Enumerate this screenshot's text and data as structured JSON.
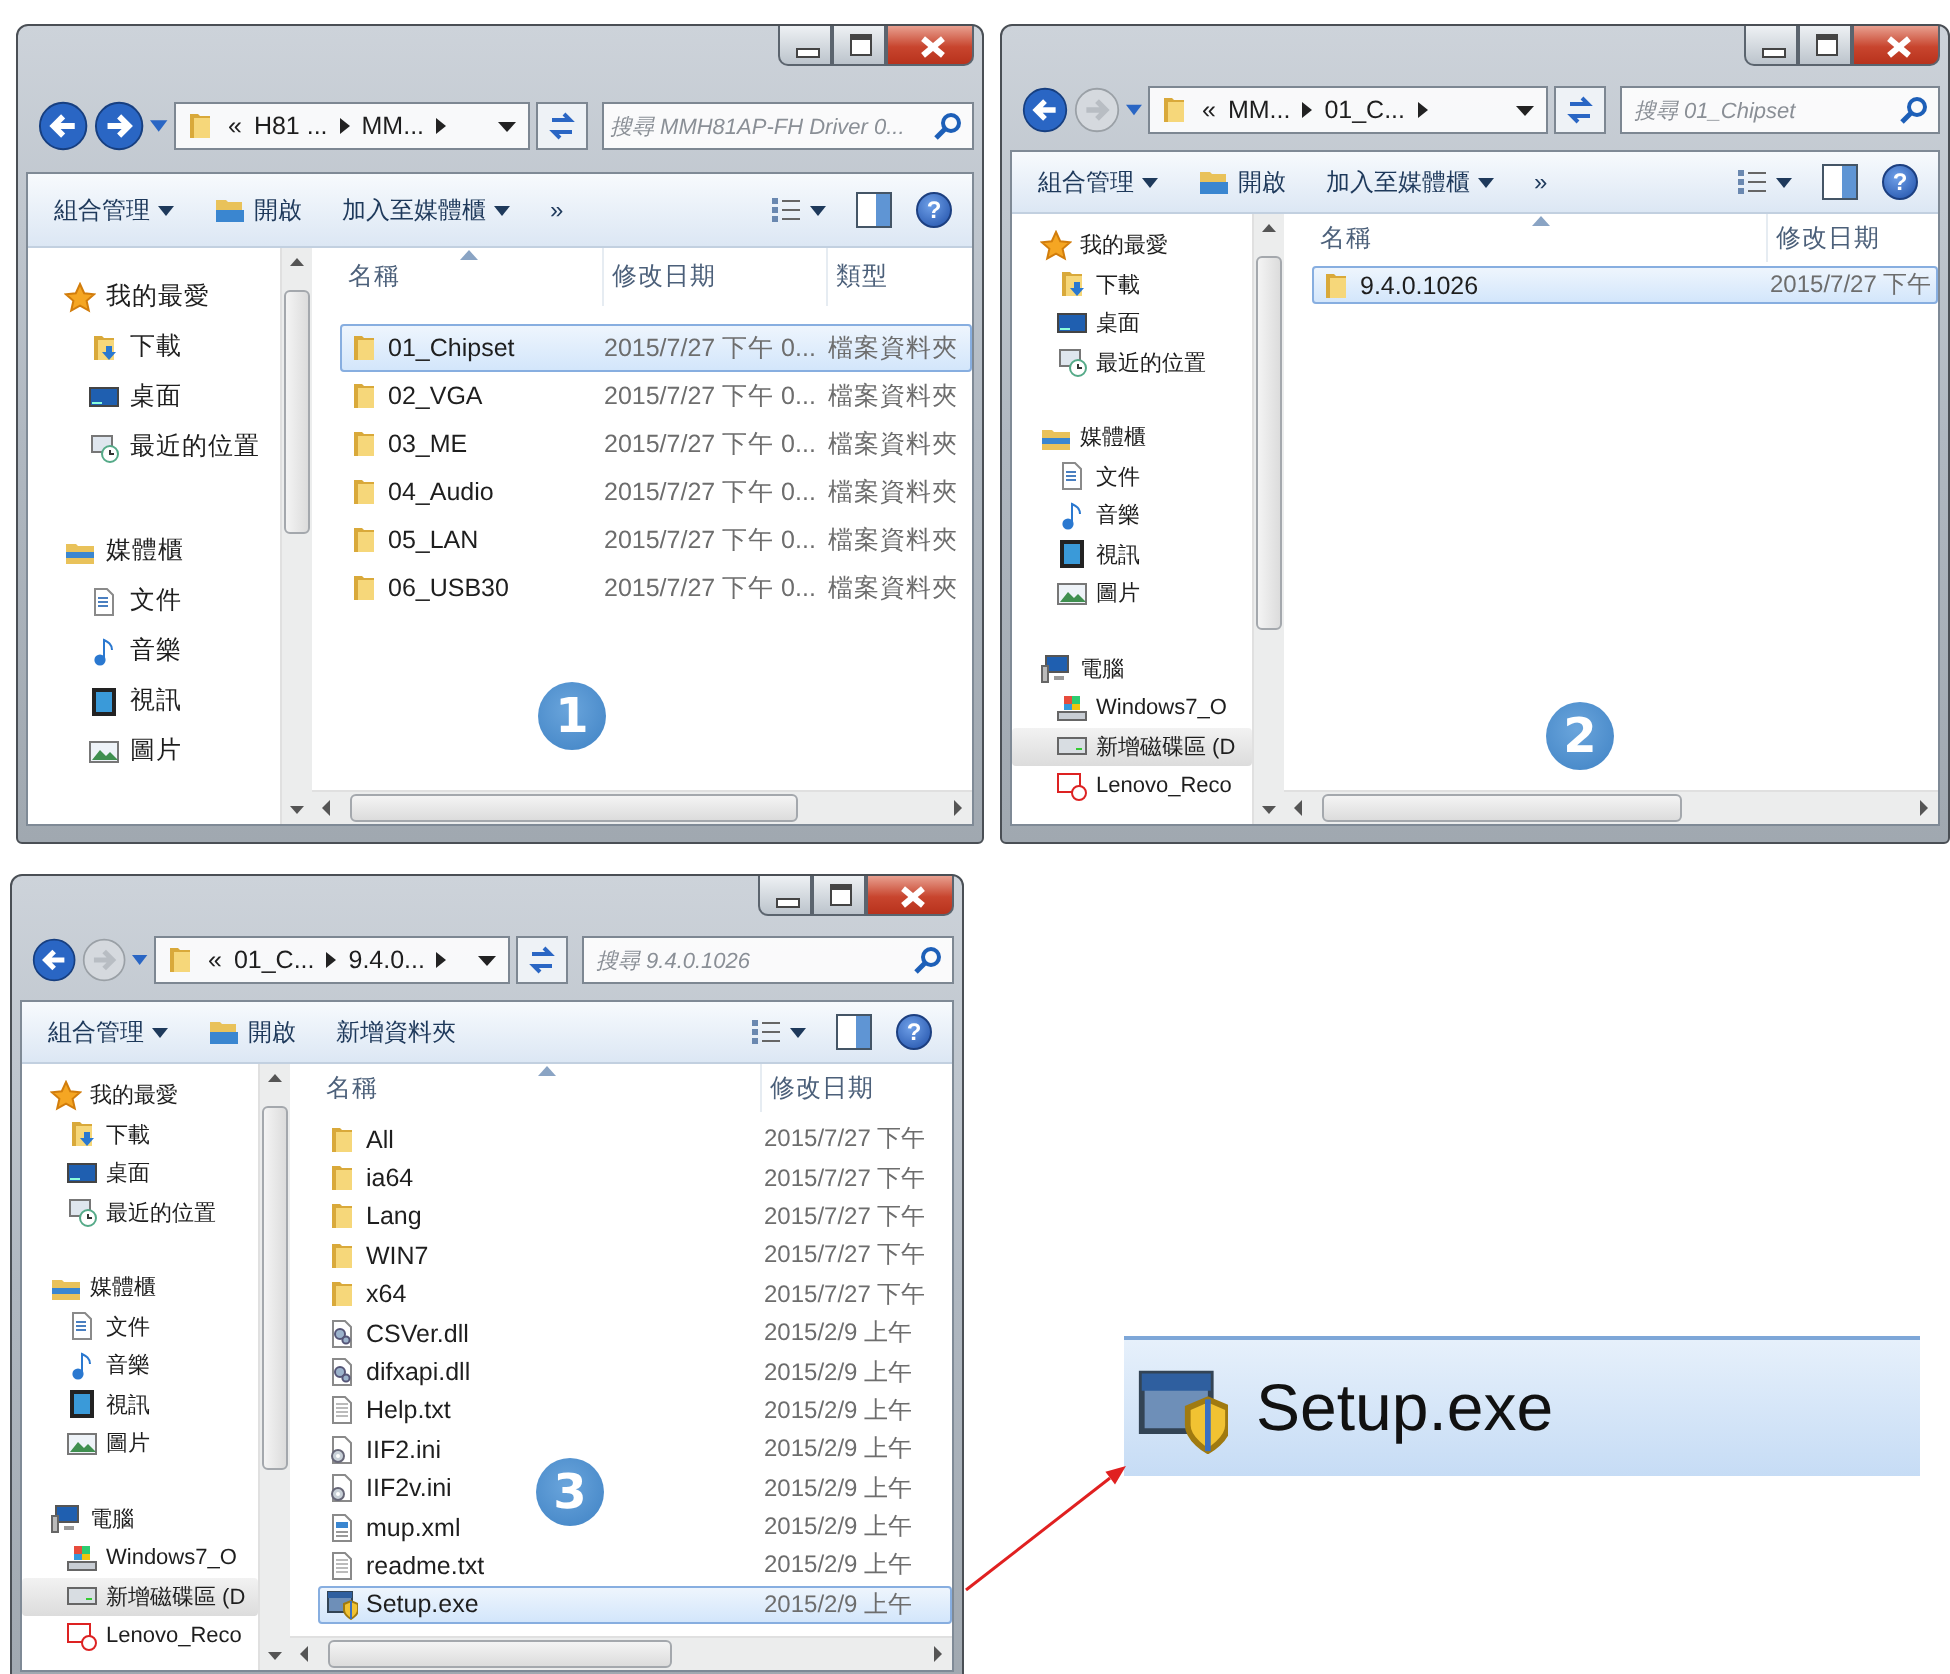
{
  "windows": [
    {
      "step": "1",
      "nav": {
        "forward_enabled": true
      },
      "address": {
        "overflow": "«",
        "segments": [
          "H81 ...",
          "MM..."
        ]
      },
      "search": {
        "placeholder": "搜尋 MMH81AP-FH Driver 0..."
      },
      "toolbar": [
        {
          "label": "組合管理",
          "kind": "menu"
        },
        {
          "label": "開啟",
          "kind": "icon-button"
        },
        {
          "label": "加入至媒體櫃",
          "kind": "menu"
        },
        {
          "label": "»",
          "kind": "more"
        }
      ],
      "help_label": "?",
      "sidebar": [
        {
          "label": "我的最愛",
          "kind": "star",
          "selected": false,
          "children": [
            {
              "label": "下載",
              "kind": "download",
              "selected": false
            },
            {
              "label": "桌面",
              "kind": "desktop",
              "selected": false
            },
            {
              "label": "最近的位置",
              "kind": "recent",
              "selected": false
            }
          ]
        },
        {
          "label": "媒體櫃",
          "kind": "library",
          "selected": false,
          "children": [
            {
              "label": "文件",
              "kind": "document",
              "selected": false
            },
            {
              "label": "音樂",
              "kind": "music",
              "selected": false
            },
            {
              "label": "視訊",
              "kind": "video",
              "selected": false
            },
            {
              "label": "圖片",
              "kind": "picture",
              "selected": false
            }
          ]
        }
      ],
      "columns": [
        "名稱",
        "修改日期",
        "類型"
      ],
      "rows": [
        {
          "name": "01_Chipset",
          "kind": "folder",
          "modified": "2015/7/27 下午 0...",
          "type": "檔案資料夾",
          "selected": true
        },
        {
          "name": "02_VGA",
          "kind": "folder",
          "modified": "2015/7/27 下午 0...",
          "type": "檔案資料夾",
          "selected": false
        },
        {
          "name": "03_ME",
          "kind": "folder",
          "modified": "2015/7/27 下午 0...",
          "type": "檔案資料夾",
          "selected": false
        },
        {
          "name": "04_Audio",
          "kind": "folder",
          "modified": "2015/7/27 下午 0...",
          "type": "檔案資料夾",
          "selected": false
        },
        {
          "name": "05_LAN",
          "kind": "folder",
          "modified": "2015/7/27 下午 0...",
          "type": "檔案資料夾",
          "selected": false
        },
        {
          "name": "06_USB30",
          "kind": "folder",
          "modified": "2015/7/27 下午 0...",
          "type": "檔案資料夾",
          "selected": false
        }
      ]
    },
    {
      "step": "2",
      "nav": {
        "forward_enabled": false
      },
      "address": {
        "overflow": "«",
        "segments": [
          "MM...",
          "01_C..."
        ]
      },
      "search": {
        "placeholder": "搜尋 01_Chipset"
      },
      "toolbar": [
        {
          "label": "組合管理",
          "kind": "menu"
        },
        {
          "label": "開啟",
          "kind": "icon-button"
        },
        {
          "label": "加入至媒體櫃",
          "kind": "menu"
        },
        {
          "label": "»",
          "kind": "more"
        }
      ],
      "help_label": "?",
      "sidebar": [
        {
          "label": "我的最愛",
          "kind": "star",
          "selected": false,
          "children": [
            {
              "label": "下載",
              "kind": "download",
              "selected": false
            },
            {
              "label": "桌面",
              "kind": "desktop",
              "selected": false
            },
            {
              "label": "最近的位置",
              "kind": "recent",
              "selected": false
            }
          ]
        },
        {
          "label": "媒體櫃",
          "kind": "library",
          "selected": false,
          "children": [
            {
              "label": "文件",
              "kind": "document",
              "selected": false
            },
            {
              "label": "音樂",
              "kind": "music",
              "selected": false
            },
            {
              "label": "視訊",
              "kind": "video",
              "selected": false
            },
            {
              "label": "圖片",
              "kind": "picture",
              "selected": false
            }
          ]
        },
        {
          "label": "電腦",
          "kind": "computer",
          "selected": false,
          "children": [
            {
              "label": "Windows7_O",
              "kind": "os-drive",
              "selected": false
            },
            {
              "label": "新增磁碟區 (D",
              "kind": "drive",
              "selected": true
            },
            {
              "label": "Lenovo_Reco",
              "kind": "recovery",
              "selected": false
            }
          ]
        }
      ],
      "columns": [
        "名稱",
        "修改日期"
      ],
      "rows": [
        {
          "name": "9.4.0.1026",
          "kind": "folder",
          "modified": "2015/7/27 下午",
          "selected": true
        }
      ]
    },
    {
      "step": "3",
      "nav": {
        "forward_enabled": false
      },
      "address": {
        "overflow": "«",
        "segments": [
          "01_C...",
          "9.4.0..."
        ]
      },
      "search": {
        "placeholder": "搜尋 9.4.0.1026"
      },
      "toolbar": [
        {
          "label": "組合管理",
          "kind": "menu"
        },
        {
          "label": "開啟",
          "kind": "icon-button"
        },
        {
          "label": "新增資料夾",
          "kind": "plain"
        }
      ],
      "help_label": "?",
      "sidebar": [
        {
          "label": "我的最愛",
          "kind": "star",
          "selected": false,
          "children": [
            {
              "label": "下載",
              "kind": "download",
              "selected": false
            },
            {
              "label": "桌面",
              "kind": "desktop",
              "selected": false
            },
            {
              "label": "最近的位置",
              "kind": "recent",
              "selected": false
            }
          ]
        },
        {
          "label": "媒體櫃",
          "kind": "library",
          "selected": false,
          "children": [
            {
              "label": "文件",
              "kind": "document",
              "selected": false
            },
            {
              "label": "音樂",
              "kind": "music",
              "selected": false
            },
            {
              "label": "視訊",
              "kind": "video",
              "selected": false
            },
            {
              "label": "圖片",
              "kind": "picture",
              "selected": false
            }
          ]
        },
        {
          "label": "電腦",
          "kind": "computer",
          "selected": false,
          "children": [
            {
              "label": "Windows7_O",
              "kind": "os-drive",
              "selected": false
            },
            {
              "label": "新增磁碟區 (D",
              "kind": "drive",
              "selected": true
            },
            {
              "label": "Lenovo_Reco",
              "kind": "recovery",
              "selected": false
            }
          ]
        }
      ],
      "columns": [
        "名稱",
        "修改日期"
      ],
      "rows": [
        {
          "name": "All",
          "kind": "folder",
          "modified": "2015/7/27 下午",
          "selected": false
        },
        {
          "name": "ia64",
          "kind": "folder",
          "modified": "2015/7/27 下午",
          "selected": false
        },
        {
          "name": "Lang",
          "kind": "folder",
          "modified": "2015/7/27 下午",
          "selected": false
        },
        {
          "name": "WIN7",
          "kind": "folder",
          "modified": "2015/7/27 下午",
          "selected": false
        },
        {
          "name": "x64",
          "kind": "folder",
          "modified": "2015/7/27 下午",
          "selected": false
        },
        {
          "name": "CSVer.dll",
          "kind": "dll",
          "modified": "2015/2/9 上午",
          "selected": false
        },
        {
          "name": "difxapi.dll",
          "kind": "dll",
          "modified": "2015/2/9 上午",
          "selected": false
        },
        {
          "name": "Help.txt",
          "kind": "txt",
          "modified": "2015/2/9 上午",
          "selected": false
        },
        {
          "name": "IIF2.ini",
          "kind": "ini",
          "modified": "2015/2/9 上午",
          "selected": false
        },
        {
          "name": "IIF2v.ini",
          "kind": "ini",
          "modified": "2015/2/9 上午",
          "selected": false
        },
        {
          "name": "mup.xml",
          "kind": "xml",
          "modified": "2015/2/9 上午",
          "selected": false
        },
        {
          "name": "readme.txt",
          "kind": "txt",
          "modified": "2015/2/9 上午",
          "selected": false
        },
        {
          "name": "Setup.exe",
          "kind": "exe",
          "modified": "2015/2/9 上午",
          "selected": true
        }
      ]
    }
  ],
  "callout": {
    "name": "Setup.exe",
    "kind": "exe"
  }
}
